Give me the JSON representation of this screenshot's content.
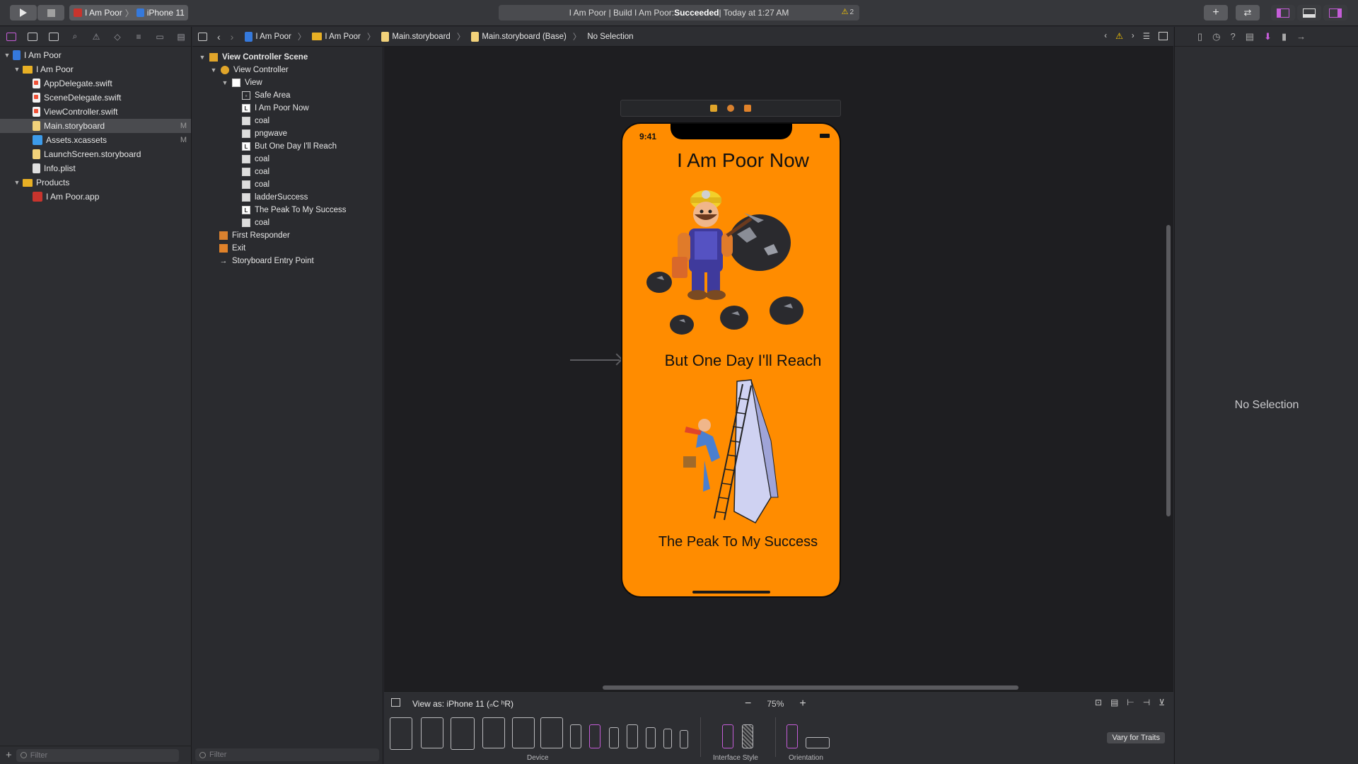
{
  "toolbar": {
    "scheme_name": "I Am Poor",
    "device_name": "iPhone 11",
    "status_prefix": "I Am Poor | Build I Am Poor: ",
    "status_result": "Succeeded",
    "status_time": " | Today at 1:27 AM",
    "warning_count": "2"
  },
  "navigator": {
    "items": [
      {
        "label": "I Am Poor",
        "badge": ""
      },
      {
        "label": "I Am Poor",
        "badge": ""
      },
      {
        "label": "AppDelegate.swift",
        "badge": ""
      },
      {
        "label": "SceneDelegate.swift",
        "badge": ""
      },
      {
        "label": "ViewController.swift",
        "badge": ""
      },
      {
        "label": "Main.storyboard",
        "badge": "M"
      },
      {
        "label": "Assets.xcassets",
        "badge": "M"
      },
      {
        "label": "LaunchScreen.storyboard",
        "badge": ""
      },
      {
        "label": "Info.plist",
        "badge": ""
      },
      {
        "label": "Products",
        "badge": ""
      },
      {
        "label": "I Am Poor.app",
        "badge": ""
      }
    ],
    "filter_placeholder": "Filter"
  },
  "jumpbar": {
    "crumbs": [
      "I Am Poor",
      "I Am Poor",
      "Main.storyboard",
      "Main.storyboard (Base)",
      "No Selection"
    ]
  },
  "outline": {
    "items": [
      "View Controller Scene",
      "View Controller",
      "View",
      "Safe Area",
      "I Am Poor Now",
      "coal",
      "pngwave",
      "But One Day I'll Reach",
      "coal",
      "coal",
      "coal",
      "ladderSuccess",
      "The Peak To My Success",
      "coal",
      "First Responder",
      "Exit",
      "Storyboard Entry Point"
    ],
    "filter_placeholder": "Filter"
  },
  "phone": {
    "time": "9:41",
    "title": "I Am Poor Now",
    "middle_text": "But One Day I'll Reach",
    "bottom_text": "The Peak To My Success",
    "background_color": "#ff8c00"
  },
  "bottombar": {
    "view_as": "View as: iPhone 11 (ₙC ʰR)",
    "zoom_level": "75%",
    "device_label": "Device",
    "interface_style_label": "Interface Style",
    "orientation_label": "Orientation",
    "vary_button": "Vary for Traits"
  },
  "inspector": {
    "empty_text": "No Selection"
  },
  "colors": {
    "accent": "#c55dd8",
    "warning": "#ffcc00"
  }
}
